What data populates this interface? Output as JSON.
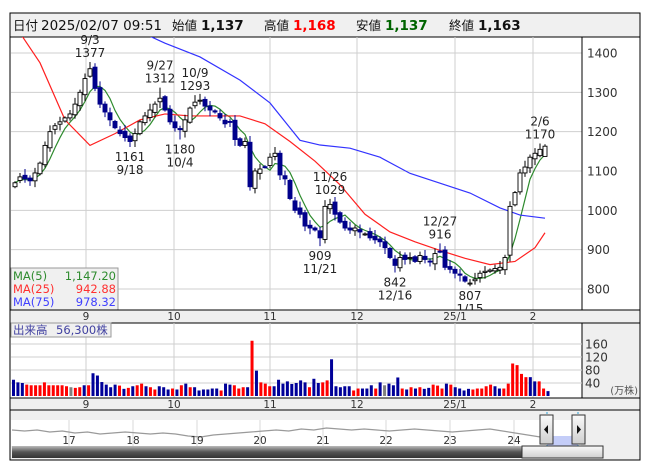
{
  "header": {
    "date_label": "日付",
    "date_value": "2025/02/07 09:51",
    "open_label": "始値",
    "open_value": "1,137",
    "high_label": "高値",
    "high_value": "1,168",
    "low_label": "安値",
    "low_value": "1,137",
    "close_label": "終値",
    "close_value": "1,163"
  },
  "legend": {
    "ma5_label": "MA(5)",
    "ma5_value": "1,147.20",
    "ma25_label": "MA(25)",
    "ma25_value": "942.88",
    "ma75_label": "MA(75)",
    "ma75_value": "978.32"
  },
  "volume_legend": {
    "label": "出来高",
    "value": "56,300株"
  },
  "colors": {
    "up_candle": "#ffffff",
    "down_candle": "#00008b",
    "ma5": "#2e8b2e",
    "ma25": "#ff2020",
    "ma75": "#3333ff",
    "vol_up": "#ff0000",
    "vol_down": "#000099",
    "vol_flat": "#808080",
    "high_value": "#ff0000",
    "low_value": "#006400"
  },
  "chart_data": [
    {
      "type": "candlestick",
      "title": "",
      "y_ticks": [
        "1400",
        "1300",
        "1200",
        "1100",
        "1000",
        "900",
        "800"
      ],
      "ylim": [
        780,
        1440
      ],
      "x_ticks": [
        "9",
        "10",
        "11",
        "12",
        "25/1",
        "2"
      ],
      "grid": true,
      "close": [
        1070,
        1085,
        1080,
        1075,
        1095,
        1120,
        1165,
        1200,
        1215,
        1225,
        1235,
        1245,
        1270,
        1300,
        1335,
        1360,
        1310,
        1270,
        1250,
        1230,
        1210,
        1195,
        1185,
        1175,
        1195,
        1225,
        1240,
        1255,
        1270,
        1285,
        1255,
        1225,
        1210,
        1205,
        1230,
        1260,
        1275,
        1280,
        1265,
        1255,
        1250,
        1235,
        1220,
        1225,
        1180,
        1165,
        1175,
        1060,
        1100,
        1105,
        1110,
        1135,
        1145,
        1090,
        1080,
        1030,
        1000,
        990,
        960,
        955,
        950,
        930,
        1010,
        1015,
        990,
        970,
        955,
        950,
        955,
        945,
        940,
        930,
        925,
        920,
        905,
        880,
        860,
        880,
        875,
        880,
        870,
        885,
        875,
        870,
        890,
        895,
        855,
        850,
        840,
        835,
        820,
        815,
        825,
        840,
        845,
        848,
        852,
        855,
        880,
        1010,
        1045,
        1095,
        1110,
        1135,
        1145,
        1155,
        1163
      ],
      "last_bar": {
        "open": 1137,
        "high": 1168,
        "low": 1137,
        "close": 1163
      },
      "annotations": [
        {
          "date": "9/3",
          "value": "1377",
          "kind": "high",
          "bar": 15
        },
        {
          "date": "9/18",
          "value": "1161",
          "kind": "low",
          "bar": 23
        },
        {
          "date": "9/27",
          "value": "1312",
          "kind": "high",
          "bar": 29
        },
        {
          "date": "10/4",
          "value": "1180",
          "kind": "low",
          "bar": 33
        },
        {
          "date": "10/9",
          "value": "1293",
          "kind": "high",
          "bar": 36
        },
        {
          "date": "11/21",
          "value": "909",
          "kind": "low",
          "bar": 61
        },
        {
          "date": "11/26",
          "value": "1029",
          "kind": "high",
          "bar": 63
        },
        {
          "date": "12/16",
          "value": "842",
          "kind": "low",
          "bar": 76
        },
        {
          "date": "12/27",
          "value": "916",
          "kind": "high",
          "bar": 85
        },
        {
          "date": "1/15",
          "value": "807",
          "kind": "low",
          "bar": 91
        },
        {
          "date": "2/6",
          "value": "1170",
          "kind": "high",
          "bar": 105
        }
      ],
      "series": [
        {
          "name": "MA(5)",
          "computed_from": "close",
          "period": 5
        },
        {
          "name": "MA(25)",
          "points": [
            [
              0,
              1470
            ],
            [
              5,
              1375
            ],
            [
              10,
              1230
            ],
            [
              15,
              1165
            ],
            [
              20,
              1195
            ],
            [
              25,
              1230
            ],
            [
              30,
              1245
            ],
            [
              35,
              1240
            ],
            [
              40,
              1240
            ],
            [
              45,
              1240
            ],
            [
              50,
              1220
            ],
            [
              55,
              1175
            ],
            [
              60,
              1125
            ],
            [
              65,
              1065
            ],
            [
              70,
              990
            ],
            [
              75,
              945
            ],
            [
              80,
              920
            ],
            [
              85,
              898
            ],
            [
              90,
              878
            ],
            [
              95,
              862
            ],
            [
              100,
              870
            ],
            [
              104,
              905
            ],
            [
              106,
              943
            ]
          ]
        },
        {
          "name": "MA(75)",
          "points": [
            [
              24,
              1460
            ],
            [
              30,
              1425
            ],
            [
              37,
              1390
            ],
            [
              45,
              1331
            ],
            [
              51,
              1273
            ],
            [
              57,
              1178
            ],
            [
              61,
              1166
            ],
            [
              67,
              1158
            ],
            [
              73,
              1135
            ],
            [
              79,
              1094
            ],
            [
              85,
              1069
            ],
            [
              91,
              1044
            ],
            [
              97,
              1006
            ],
            [
              101,
              988
            ],
            [
              106,
              980
            ]
          ]
        }
      ]
    },
    {
      "type": "bar",
      "title": "出来高",
      "unit": "(万株)",
      "y_ticks": [
        "160",
        "120",
        "80",
        "40"
      ],
      "ylim": [
        0,
        170
      ],
      "x_ticks": [
        "9",
        "10",
        "11",
        "12",
        "25/1",
        "2"
      ],
      "values": [
        50,
        42,
        40,
        35,
        33,
        33,
        33,
        42,
        33,
        33,
        33,
        33,
        30,
        27,
        25,
        27,
        33,
        33,
        70,
        63,
        43,
        35,
        27,
        35,
        32,
        22,
        25,
        30,
        33,
        38,
        30,
        27,
        20,
        30,
        27,
        20,
        23,
        20,
        33,
        38,
        27,
        27,
        17,
        20,
        20,
        23,
        23,
        17,
        38,
        35,
        33,
        23,
        27,
        27,
        170,
        78,
        42,
        38,
        30,
        30,
        50,
        38,
        45,
        37,
        40,
        48,
        42,
        27,
        53,
        40,
        42,
        48,
        113,
        30,
        27,
        30,
        30,
        17,
        23,
        23,
        23,
        33,
        23,
        42,
        33,
        38,
        33,
        57,
        23,
        20,
        27,
        23,
        27,
        22,
        25,
        35,
        32,
        23,
        38,
        35,
        27,
        23,
        17,
        22,
        20,
        23,
        23,
        30,
        35,
        30,
        23,
        23,
        38,
        100,
        95,
        68,
        58,
        58,
        45,
        45,
        23,
        15
      ],
      "direction": "dddrrrrrrrrrrnrrdrddddddrdrdrrdrrdddrdrdrddddddrddrrrdrdrrrddddddddrddrrdddddrrdddrdnddd rdrdrddrrrdrddddrrrrrddrrrrrrddrr"
    }
  ],
  "navigator": {
    "year_labels": [
      "17",
      "18",
      "19",
      "20",
      "21",
      "22",
      "23",
      "24"
    ],
    "series": [
      430,
      431,
      430,
      432,
      431,
      433,
      432,
      434,
      433,
      432,
      433,
      434,
      433,
      434,
      436,
      437,
      435,
      434,
      433,
      432,
      431,
      430,
      431,
      429,
      430,
      428,
      429,
      430,
      429,
      430,
      431,
      430,
      429,
      430,
      431,
      432,
      431,
      430,
      429,
      431,
      433,
      435,
      437,
      438,
      437,
      436
    ]
  }
}
